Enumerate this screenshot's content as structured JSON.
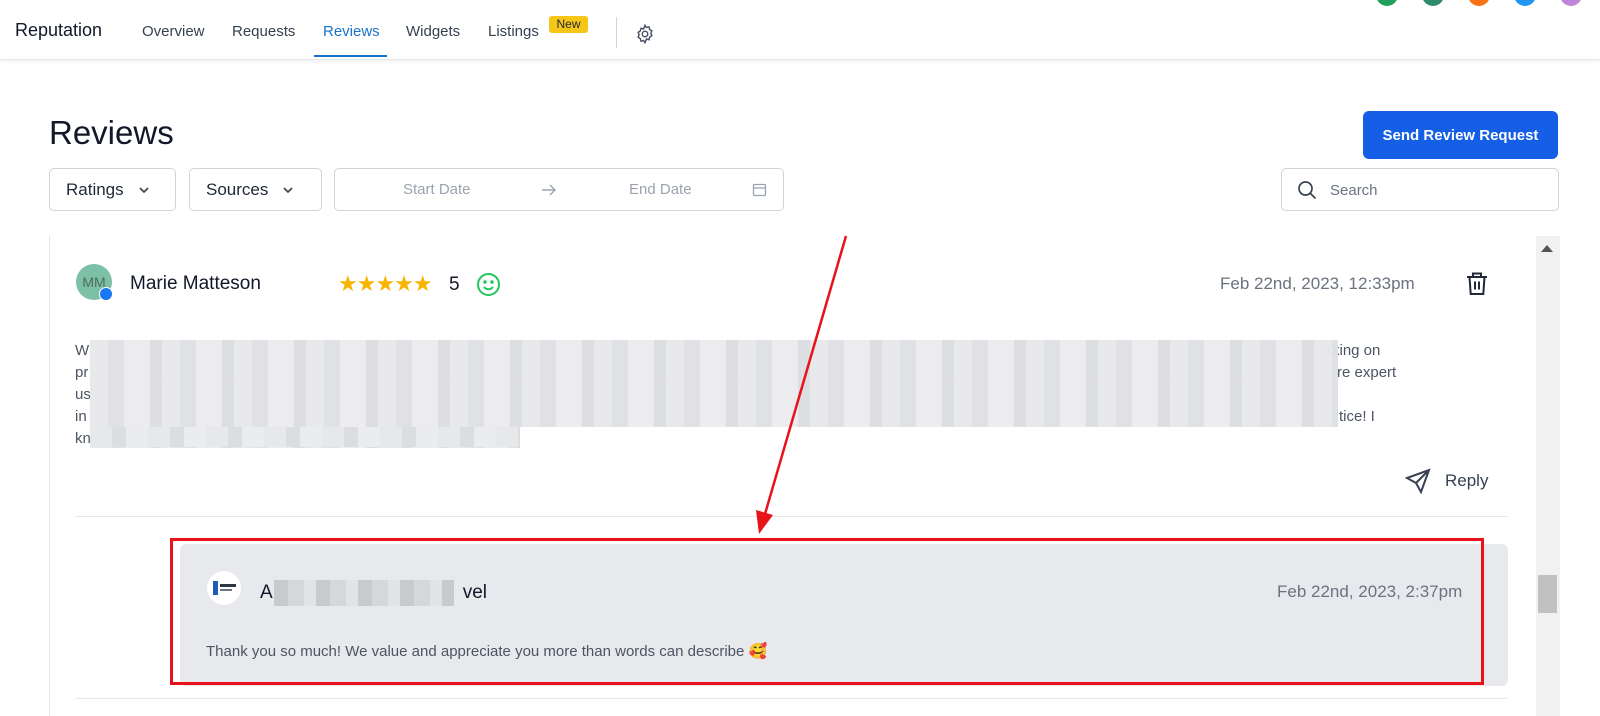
{
  "nav": {
    "brand": "Reputation",
    "tabs": [
      {
        "label": "Overview"
      },
      {
        "label": "Requests"
      },
      {
        "label": "Reviews"
      },
      {
        "label": "Widgets"
      },
      {
        "label": "Listings"
      }
    ],
    "active_tab": "Reviews",
    "new_badge": "New"
  },
  "header": {
    "title": "Reviews",
    "send_button": "Send Review Request"
  },
  "filters": {
    "ratings": "Ratings",
    "sources": "Sources",
    "start_date_placeholder": "Start Date",
    "end_date_placeholder": "End Date",
    "search_placeholder": "Search"
  },
  "review": {
    "avatar_initials": "MM",
    "reviewer_name": "Marie Matteson",
    "stars": "★★★★★",
    "rating": "5",
    "date": "Feb 22nd, 2023, 12:33pm",
    "text_lines": [
      {
        "start": "W",
        "end": "rking on"
      },
      {
        "start": "pr",
        "end": "re expert"
      },
      {
        "start": "us",
        "end": ""
      },
      {
        "start": "in",
        "end": "tice! I"
      },
      {
        "start": "kn",
        "end": ""
      }
    ],
    "reply_label": "Reply"
  },
  "owner_reply": {
    "name_start": "A",
    "name_end": "vel",
    "date": "Feb 22nd, 2023, 2:37pm",
    "text": "Thank you so much! We value and appreciate you more than words can describe 🥰"
  },
  "colors": {
    "accent": "#1a73c8",
    "primary_button": "#155ee6",
    "star": "#f7b500",
    "sentiment": "#22c55e",
    "annotation": "#e8121a",
    "badge": "#f5c518"
  }
}
